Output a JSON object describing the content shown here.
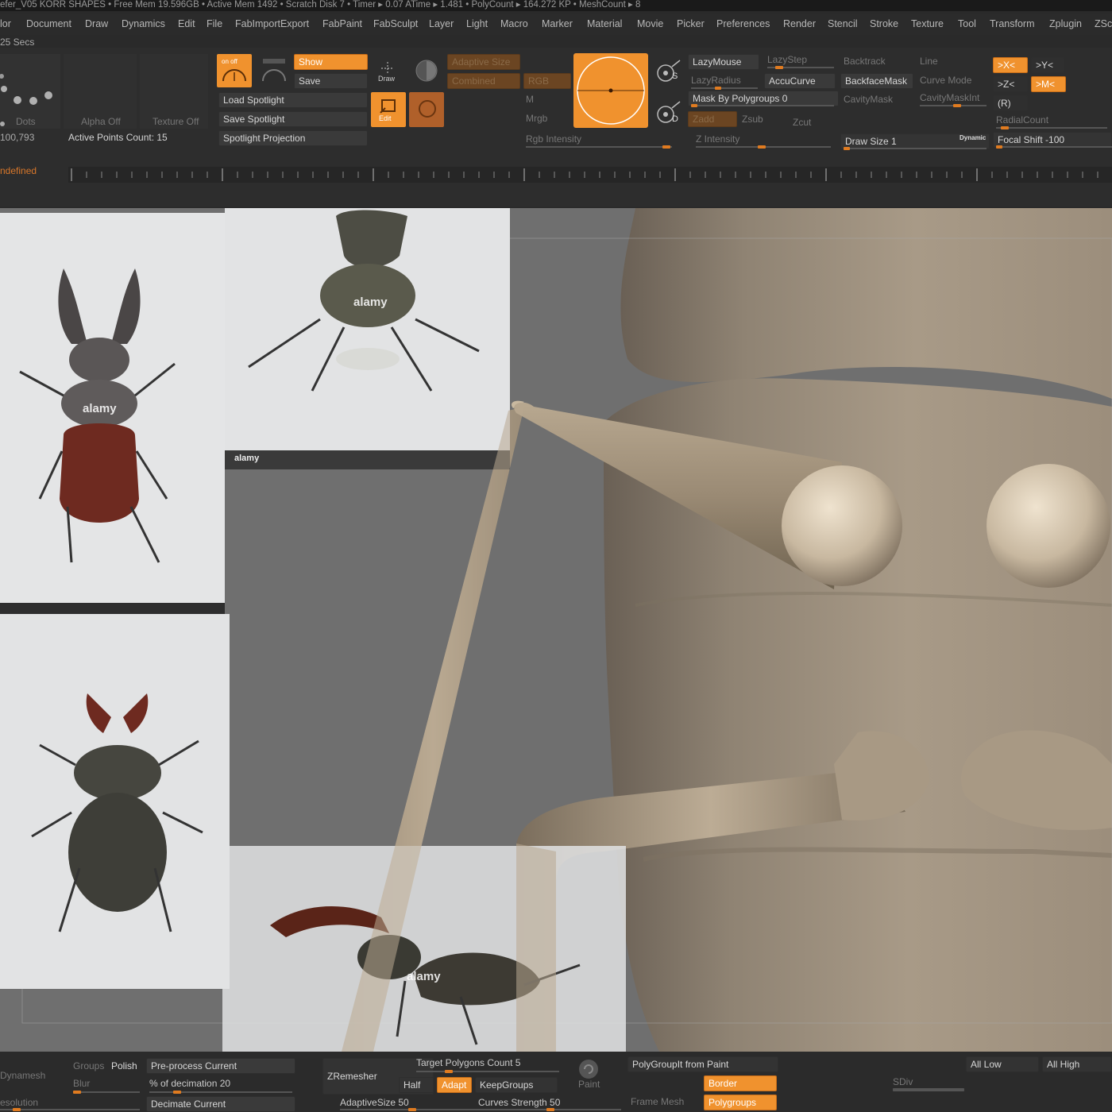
{
  "titlebar": {
    "text": "efer_V05 KORR SHAPES    • Free Mem 19.596GB • Active Mem 1492 • Scratch Disk 7 • Timer ▸ 0.07 ATime ▸ 1.481 • PolyCount ▸ 164.272 KP • MeshCount ▸ 8"
  },
  "menu": [
    "lor",
    "Document",
    "Draw",
    "Dynamics",
    "Edit",
    "File",
    "FabImportExport",
    "FabPaint",
    "FabSculpt",
    "Layer",
    "Light",
    "Macro",
    "Marker",
    "Material",
    "Movie",
    "Picker",
    "Preferences",
    "Render",
    "Stencil",
    "Stroke",
    "Texture",
    "Tool",
    "Transform",
    "Zplugin",
    "ZSc"
  ],
  "status": {
    "secs": "25 Secs",
    "count": "100,793",
    "undefined": "ndefined"
  },
  "brushpanel": {
    "dots": "Dots",
    "alpha": "Alpha Off",
    "texture": "Texture Off",
    "active_points": "Active Points Count: 15"
  },
  "spotlight": {
    "onoff": "on  off",
    "show": "Show",
    "save": "Save",
    "load": "Load Spotlight",
    "save_spot": "Save Spotlight",
    "projection": "Spotlight Projection"
  },
  "modes": {
    "draw": "Draw",
    "edit": "Edit"
  },
  "rgb": {
    "adaptive": "Adaptive Size",
    "combined": "Combined",
    "rgb": "RGB",
    "m": "M",
    "mrgb": "Mrgb",
    "intensity": "Rgb Intensity"
  },
  "stroke": {
    "lazymouse": "LazyMouse",
    "lazystep": "LazyStep",
    "lazyradius": "LazyRadius",
    "accucurve": "AccuCurve",
    "mask_polygroups": "Mask By Polygroups 0",
    "backtrack": "Backtrack",
    "line": "Line",
    "backfacemask": "BackfaceMask",
    "curvemode": "Curve Mode",
    "cavitymask": "CavityMask",
    "cavitymaskint": "CavityMaskInt",
    "s": "S",
    "d": "D",
    "zadd": "Zadd",
    "zsub": "Zsub",
    "zcut": "Zcut",
    "zintensity": "Z Intensity",
    "drawsize": "Draw Size 1",
    "dynamic": "Dynamic",
    "focalshift": "Focal Shift -100"
  },
  "symmetry": {
    "x": ">X<",
    "y": ">Y<",
    "z": ">Z<",
    "m": ">M<",
    "r": "(R)",
    "radial": "RadialCount"
  },
  "viewport": {
    "watermark": "alamy",
    "ref_caption": "alamy"
  },
  "bottom": {
    "dynamesh": "Dynamesh",
    "groups": "Groups",
    "polish": "Polish",
    "blur": "Blur",
    "resolution": "esolution",
    "preprocess": "Pre-process Current",
    "decimation": "% of decimation 20",
    "decimate": "Decimate Current",
    "zremesher": "ZRemesher",
    "target": "Target Polygons Count 5",
    "half": "Half",
    "adapt": "Adapt",
    "keepgroups": "KeepGroups",
    "adaptivesize": "AdaptiveSize 50",
    "curves": "Curves Strength 50",
    "paint": "Paint",
    "polygroupit": "PolyGroupIt from Paint",
    "border": "Border",
    "framemesh": "Frame Mesh",
    "polygroups": "Polygroups",
    "alllow": "All Low",
    "allhigh": "All High",
    "sdiv": "SDiv"
  },
  "colors": {
    "accent": "#f0922e",
    "panel": "#2d2d2d",
    "viewport": "#6f6f6f",
    "model": "#a99b88"
  }
}
